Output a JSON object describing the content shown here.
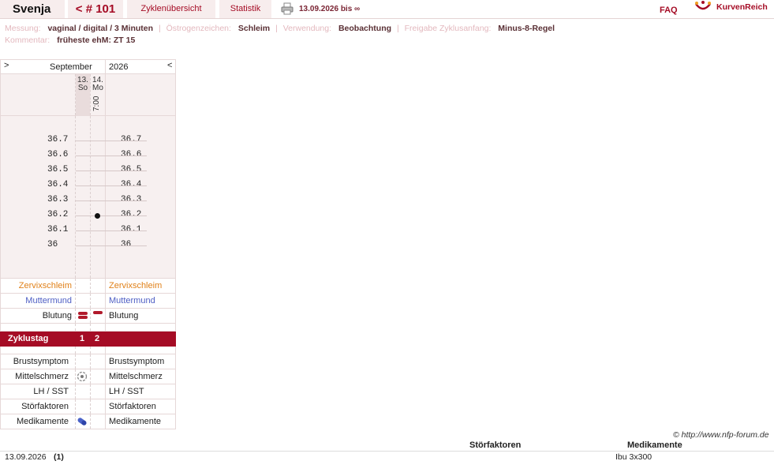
{
  "topbar": {
    "user": "Svenja",
    "cycle": "< # 101",
    "overview": "Zyklenübersicht",
    "statistics": "Statistik",
    "date_range": "13.09.2026 bis ∞",
    "faq": "FAQ",
    "logo": "KurvenReich"
  },
  "info": {
    "measurement_label": "Messung:",
    "measurement_value": "vaginal / digital / 3 Minuten",
    "estrogen_label": "Östrogenzeichen:",
    "estrogen_value": "Schleim",
    "usage_label": "Verwendung:",
    "usage_value": "Beobachtung",
    "release_label": "Freigabe Zyklusanfang:",
    "release_value": "Minus-8-Regel",
    "comment_label": "Kommentar:",
    "comment_value": "früheste ehM: ZT 15"
  },
  "chart": {
    "prev_arrow": ">",
    "next_arrow": "<",
    "month": "September",
    "year": "2026",
    "days": [
      {
        "date": "13.",
        "weekday": "So",
        "time": ""
      },
      {
        "date": "14.",
        "weekday": "Mo",
        "time": "7:00"
      }
    ],
    "temps": [
      "36.7",
      "36.6",
      "36.5",
      "36.4",
      "36.3",
      "36.2",
      "36.1",
      "36"
    ],
    "measured_temp": 36.2,
    "rows": {
      "mucus": "Zervixschleim",
      "cervix": "Muttermund",
      "bleeding": "Blutung",
      "cycle_day": "Zyklustag",
      "breast": "Brustsymptom",
      "midpain": "Mittelschmerz",
      "lh": "LH / SST",
      "disturb": "Störfaktoren",
      "meds": "Medikamente"
    },
    "cycle_days": [
      "1",
      "2"
    ]
  },
  "footer": {
    "copyright": "© http://www.nfp-forum.de",
    "col_disturb": "Störfaktoren",
    "col_meds": "Medikamente",
    "entry_date": "13.09.2026",
    "entry_count": "(1)",
    "entry_meds": "Ibu 3x300"
  },
  "colors": {
    "accent": "#a50c25",
    "mucus": "#e08018",
    "cervix": "#4e5ec4"
  }
}
